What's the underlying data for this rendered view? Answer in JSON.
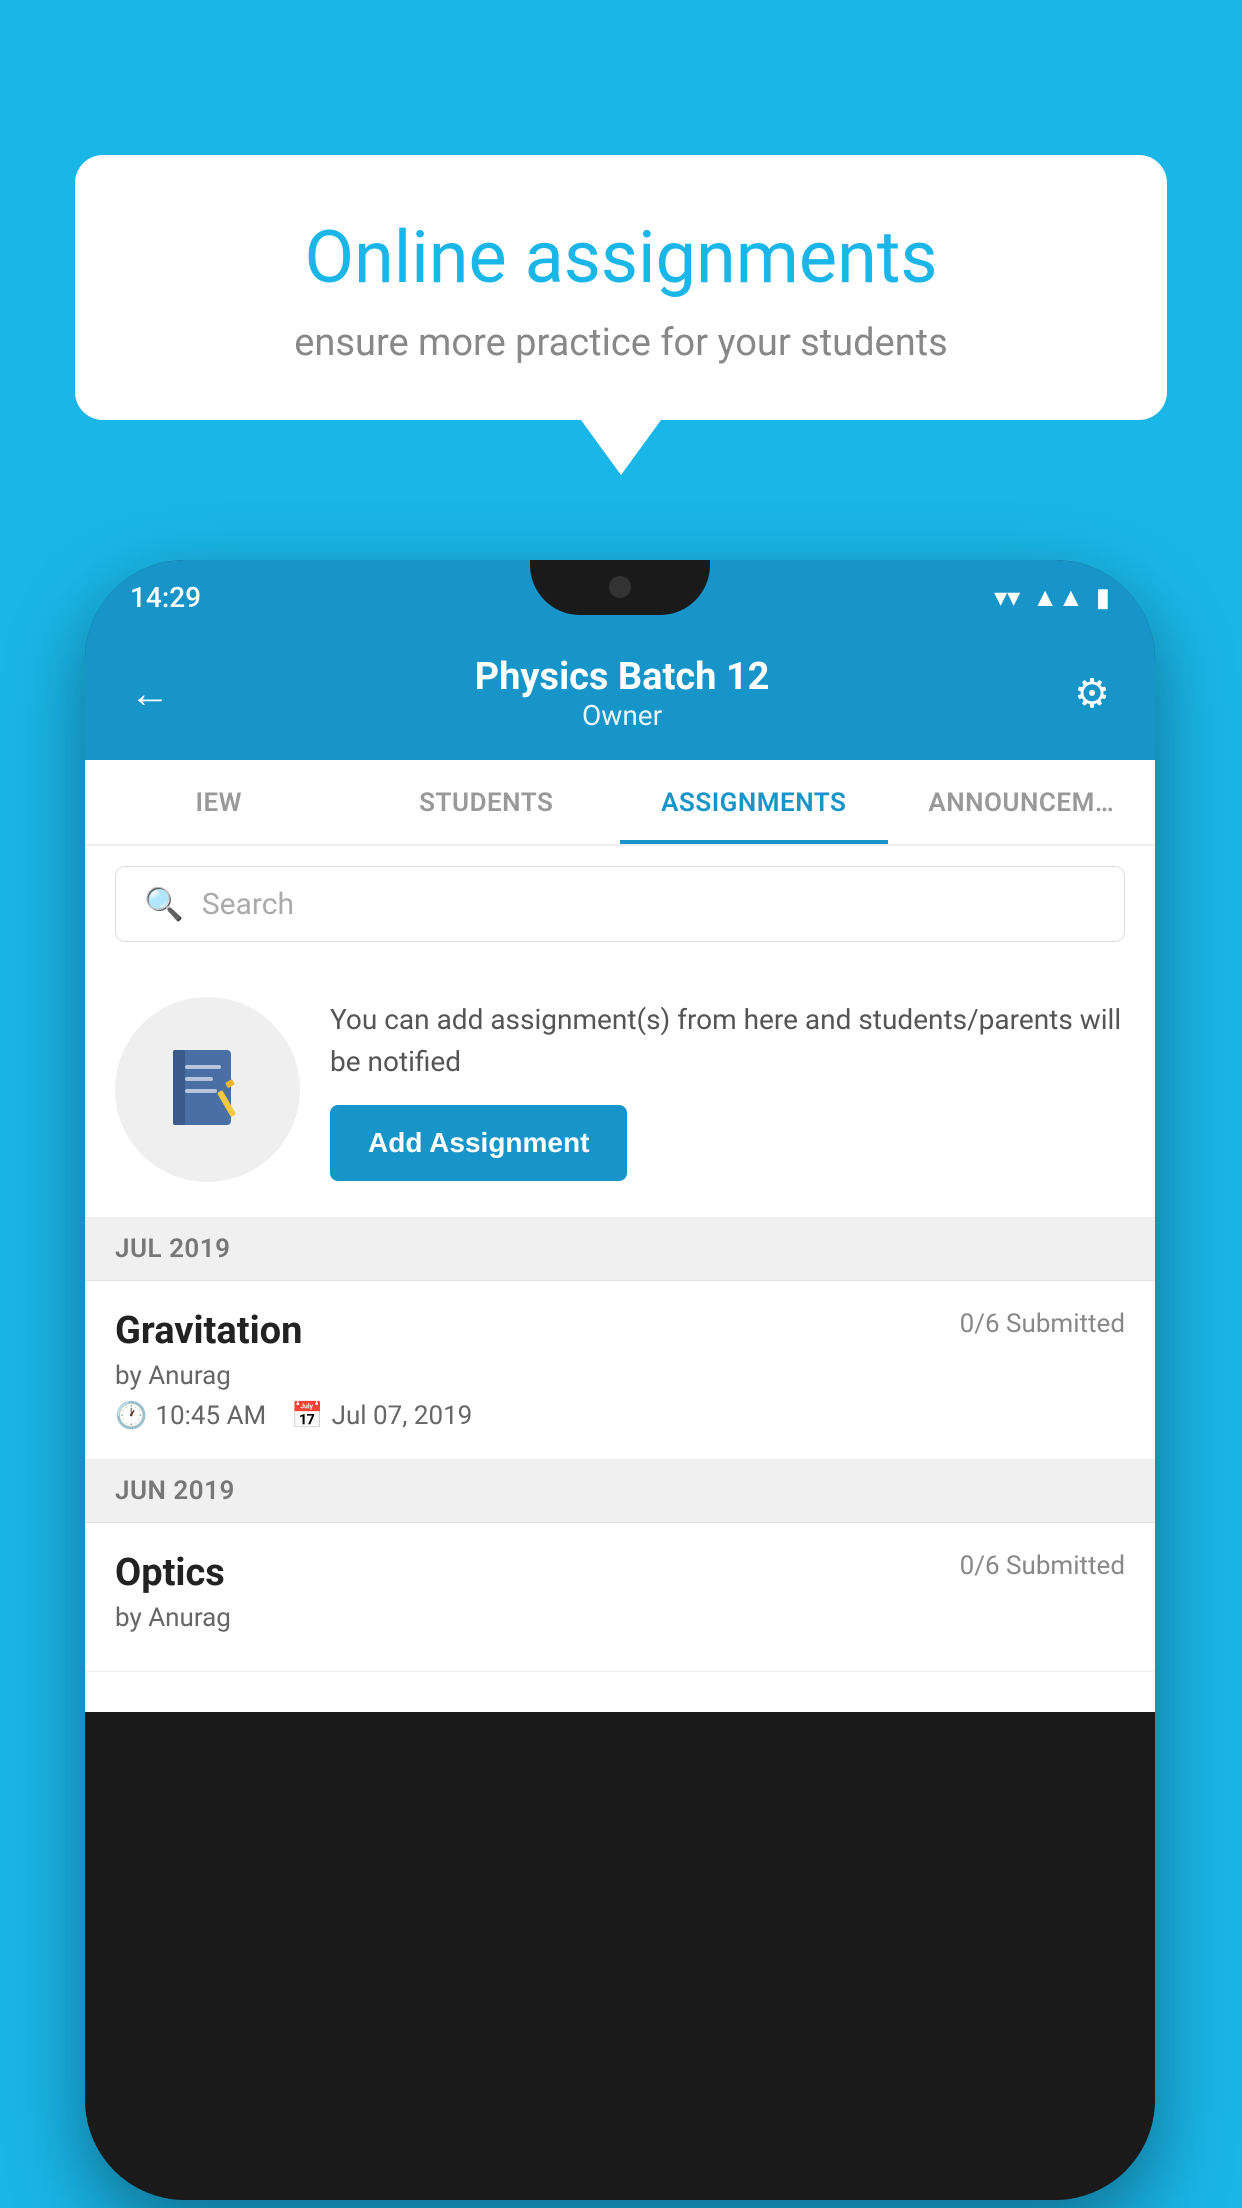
{
  "background_color": "#1ab6e8",
  "speech_bubble": {
    "title": "Online assignments",
    "subtitle": "ensure more practice for your students"
  },
  "status_bar": {
    "time": "14:29",
    "icons": [
      "wifi",
      "signal",
      "battery"
    ]
  },
  "app_header": {
    "title": "Physics Batch 12",
    "subtitle": "Owner",
    "back_label": "←",
    "settings_label": "⚙"
  },
  "tabs": [
    {
      "label": "IEW",
      "active": false
    },
    {
      "label": "STUDENTS",
      "active": false
    },
    {
      "label": "ASSIGNMENTS",
      "active": true
    },
    {
      "label": "ANNOUNCEM…",
      "active": false
    }
  ],
  "search": {
    "placeholder": "Search"
  },
  "promo": {
    "text": "You can add assignment(s) from here and students/parents will be notified",
    "button_label": "Add Assignment"
  },
  "sections": [
    {
      "label": "JUL 2019",
      "assignments": [
        {
          "name": "Gravitation",
          "submitted": "0/6 Submitted",
          "author": "by Anurag",
          "time": "10:45 AM",
          "date": "Jul 07, 2019"
        }
      ]
    },
    {
      "label": "JUN 2019",
      "assignments": [
        {
          "name": "Optics",
          "submitted": "0/6 Submitted",
          "author": "by Anurag",
          "time": "",
          "date": ""
        }
      ]
    }
  ]
}
